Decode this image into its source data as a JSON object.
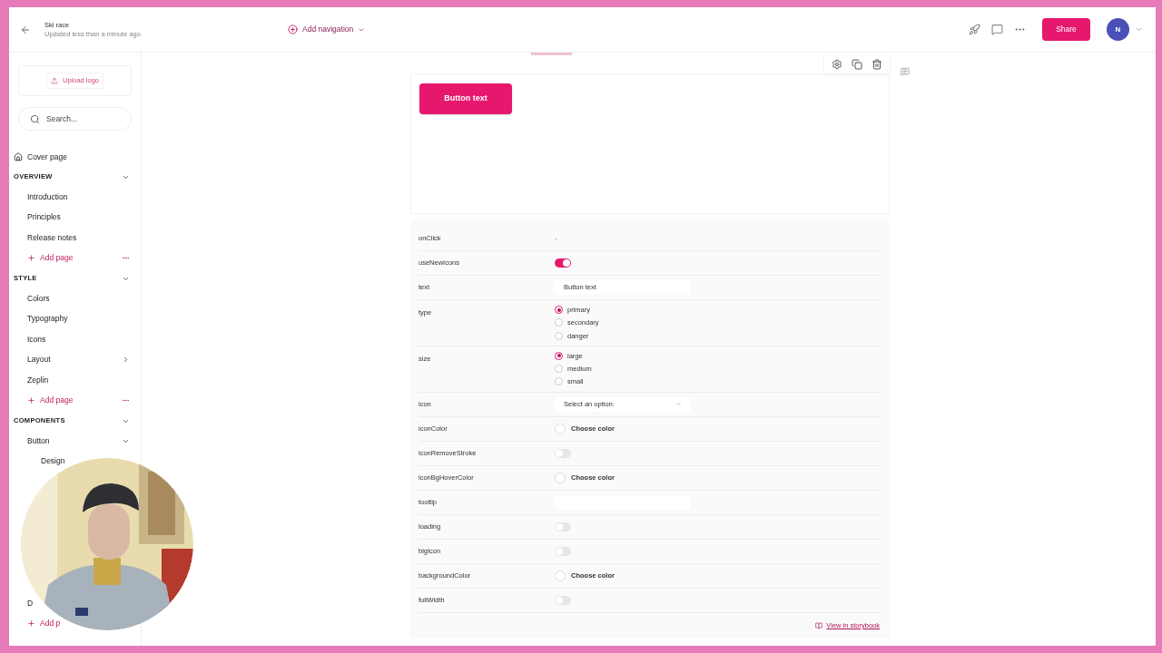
{
  "header": {
    "title": "Ski race",
    "subtitle": "Updated less than a minute ago",
    "add_navigation": "Add navigation",
    "share": "Share",
    "avatar": "N"
  },
  "sidebar": {
    "upload_logo": "Upload logo",
    "search": {
      "placeholder": "Search..."
    },
    "cover_page": "Cover page",
    "sections": [
      {
        "title": "OVERVIEW",
        "expanded": true,
        "items": [
          {
            "label": "Introduction"
          },
          {
            "label": "Principles"
          },
          {
            "label": "Release notes"
          }
        ],
        "add_page": "Add page"
      },
      {
        "title": "STYLE",
        "expanded": true,
        "items": [
          {
            "label": "Colors"
          },
          {
            "label": "Typography"
          },
          {
            "label": "Icons"
          },
          {
            "label": "Layout",
            "expanded": false
          },
          {
            "label": "Zeplin"
          }
        ],
        "add_page": "Add page"
      },
      {
        "title": "COMPONENTS",
        "expanded": true,
        "items": [
          {
            "label": "Button",
            "expanded": true,
            "children": [
              {
                "label": "Design"
              }
            ]
          },
          {
            "label": "D"
          }
        ],
        "add_page": "Add p"
      }
    ]
  },
  "preview": {
    "button": "Button text"
  },
  "props": [
    {
      "name": "onClick",
      "kind": "text",
      "value": "-"
    },
    {
      "name": "useNewIcons",
      "kind": "toggle",
      "on": true
    },
    {
      "name": "text",
      "kind": "input",
      "value": "Button text"
    },
    {
      "name": "type",
      "kind": "radio",
      "options": [
        {
          "label": "primary",
          "selected": true
        },
        {
          "label": "secondary",
          "selected": false
        },
        {
          "label": "danger",
          "selected": false
        }
      ]
    },
    {
      "name": "size",
      "kind": "radio",
      "options": [
        {
          "label": "large",
          "selected": true
        },
        {
          "label": "medium",
          "selected": false
        },
        {
          "label": "small",
          "selected": false
        }
      ]
    },
    {
      "name": "icon",
      "kind": "select",
      "placeholder": "Select an option:"
    },
    {
      "name": "iconColor",
      "kind": "color",
      "label": "Choose color"
    },
    {
      "name": "iconRemoveStroke",
      "kind": "toggle",
      "on": false
    },
    {
      "name": "iconBgHoverColor",
      "kind": "color",
      "label": "Choose color"
    },
    {
      "name": "tooltip",
      "kind": "input"
    },
    {
      "name": "loading",
      "kind": "toggle",
      "on": false
    },
    {
      "name": "bigIcon",
      "kind": "toggle",
      "on": false
    },
    {
      "name": "backgroundColor",
      "kind": "color",
      "label": "Choose color"
    },
    {
      "name": "fullWidth",
      "kind": "toggle",
      "on": false
    }
  ],
  "storybook_link": "View in storybook"
}
